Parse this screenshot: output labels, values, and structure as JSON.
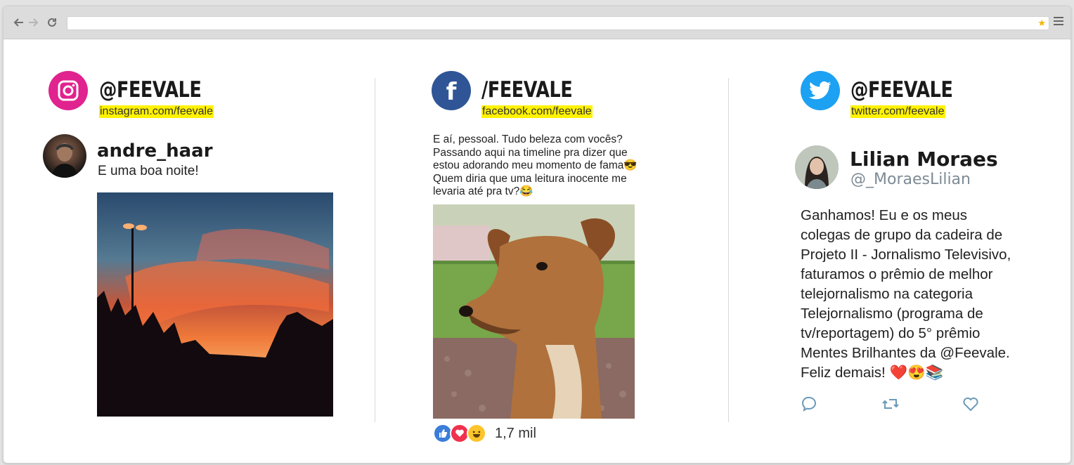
{
  "browser": {
    "back_icon": "back-arrow-icon",
    "forward_icon": "forward-arrow-icon",
    "reload_icon": "reload-icon",
    "address_value": "",
    "bookmark_icon": "star-icon",
    "menu_icon": "hamburger-menu-icon"
  },
  "instagram": {
    "icon": "instagram-icon",
    "handle": "@FEEVALE",
    "url": "instagram.com/feevale",
    "post": {
      "username": "andre_haar",
      "caption": "E uma boa noite!"
    },
    "brand_color": "#e0238e"
  },
  "facebook": {
    "icon": "facebook-icon",
    "handle": "/FEEVALE",
    "url": "facebook.com/feevale",
    "post": {
      "text": "E aí, pessoal. Tudo beleza com vocês?\nPassando aqui na timeline pra dizer que\nestou adorando meu momento de fama😎\nQuem diria que uma leitura inocente me\nlevaria até pra tv?😂",
      "reactions": [
        "like-icon",
        "love-icon",
        "haha-icon"
      ],
      "reaction_count": "1,7 mil"
    },
    "brand_color": "#2f5597"
  },
  "twitter": {
    "icon": "twitter-bird-icon",
    "handle": "@FEEVALE",
    "url": "twitter.com/feevale",
    "tweet": {
      "name": "Lilian Moraes",
      "username": "@_MoraesLilian",
      "text_before": "Ganhamos! Eu e os meus\ncolegas de grupo da cadeira de\nProjeto II - Jornalismo Televisivo,\nfaturamos o prêmio de melhor\ntelejornalismo na categoria\nTelejornalismo (programa de\ntv/reportagem) do 5° prêmio\nMentes Brilhantes da ",
      "mention": "@Feevale",
      "text_after": ".\nFeliz demais! ❤️😍📚",
      "actions": [
        "reply-icon",
        "retweet-icon",
        "like-heart-icon"
      ]
    },
    "brand_color": "#1da1f2"
  },
  "colors": {
    "highlight": "#fff200",
    "twitter_action": "#6a9ab9"
  }
}
